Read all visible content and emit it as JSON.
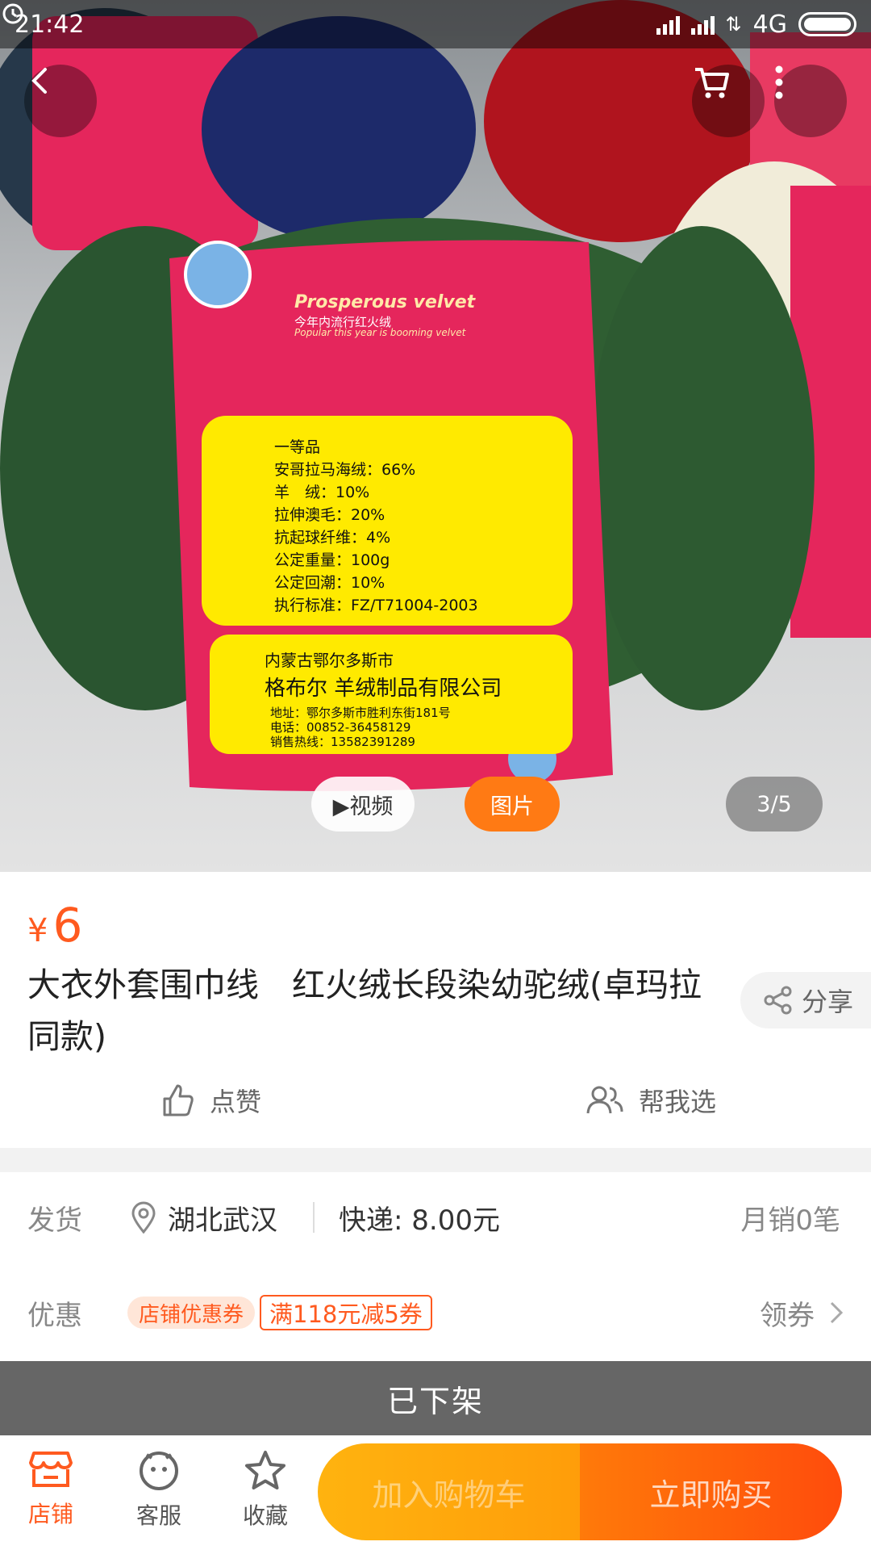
{
  "status_bar": {
    "time": "21:42",
    "network": "4G"
  },
  "media": {
    "video_label": "▶视频",
    "photo_label": "图片",
    "counter": "3/5"
  },
  "product": {
    "currency": "¥",
    "price": "6",
    "title": "大衣外套围巾线　红火绒长段染幼驼绒(卓玛拉同款)",
    "share_label": "分享"
  },
  "actions": {
    "like_label": "点赞",
    "help_label": "帮我选"
  },
  "shipping": {
    "label": "发货",
    "location": "湖北武汉",
    "fee": "快递: 8.00元",
    "monthly_sales": "月销0笔"
  },
  "promo": {
    "label": "优惠",
    "store_tag": "店铺优惠券",
    "coupon": "满118元减5券",
    "get_label": "领券"
  },
  "status_banner": "已下架",
  "bottom_bar": {
    "store_label": "店铺",
    "service_label": "客服",
    "favorite_label": "收藏",
    "add_cart_label": "加入购物车",
    "buy_now_label": "立即购买"
  },
  "label_card": {
    "lines": [
      "一等品",
      "安哥拉马海绒：66%",
      "羊　绒：10%",
      "拉伸澳毛：20%",
      "抗起球纤维：4%",
      "公定重量：100g",
      "公定回潮：10%",
      "执行标准：FZ/T71004-2003"
    ],
    "brand_line1": "内蒙古鄂尔多斯市",
    "brand_line2": "格布尔 羊绒制品有限公司",
    "address": "地址：鄂尔多斯市胜利东街181号",
    "phone": "电话：00852-36458129",
    "hotline": "销售热线：13582391289",
    "english_title": "Prosperous velvet",
    "cn_subtitle": "今年内流行红火绒",
    "english_sub": "Popular this year is booming velvet"
  },
  "colors": {
    "accent": "#ff5a1f",
    "banner": "#666666",
    "cart": "#ffa50c",
    "buy": "#ff5a0c"
  }
}
